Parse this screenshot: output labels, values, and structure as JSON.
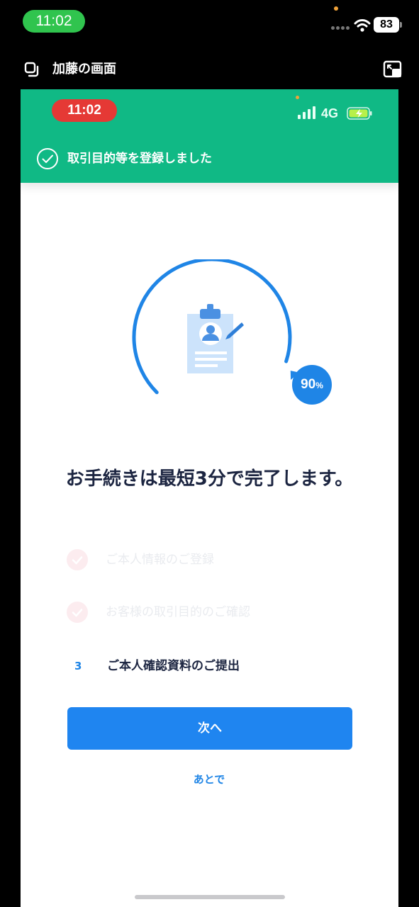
{
  "outer_status": {
    "time": "11:02",
    "battery": "83",
    "icons": [
      "signal-dots-icon",
      "wifi-icon",
      "battery-icon"
    ]
  },
  "share_header": {
    "title": "加藤の画面",
    "left_icon": "copy-icon",
    "right_icon": "picture-in-picture-icon"
  },
  "inner_status": {
    "time": "11:02",
    "network": "4G",
    "icons": [
      "cellular-signal-icon",
      "charging-battery-icon"
    ]
  },
  "toast": {
    "icon": "check-circle-icon",
    "text": "取引目的等を登録しました"
  },
  "progress": {
    "percent_value": "90",
    "percent_unit": "%",
    "fraction": 0.9,
    "center_icon": "clipboard-profile-pencil-icon"
  },
  "headline": "お手続きは最短3分で完了します。",
  "steps": [
    {
      "label": "ご本人情報のご登録",
      "status": "done",
      "icon": "check-circle-icon"
    },
    {
      "label": "お客様の取引目的のご確認",
      "status": "done",
      "icon": "check-circle-icon"
    },
    {
      "number": "3",
      "label": "ご本人確認資料のご提出",
      "status": "current"
    }
  ],
  "buttons": {
    "next": "次へ",
    "later": "あとで"
  },
  "colors": {
    "header_green": "#10b985",
    "accent_blue": "#1f85f0",
    "status_red": "#e53935",
    "status_green": "#30c44e",
    "text_dark": "#1c2541"
  }
}
